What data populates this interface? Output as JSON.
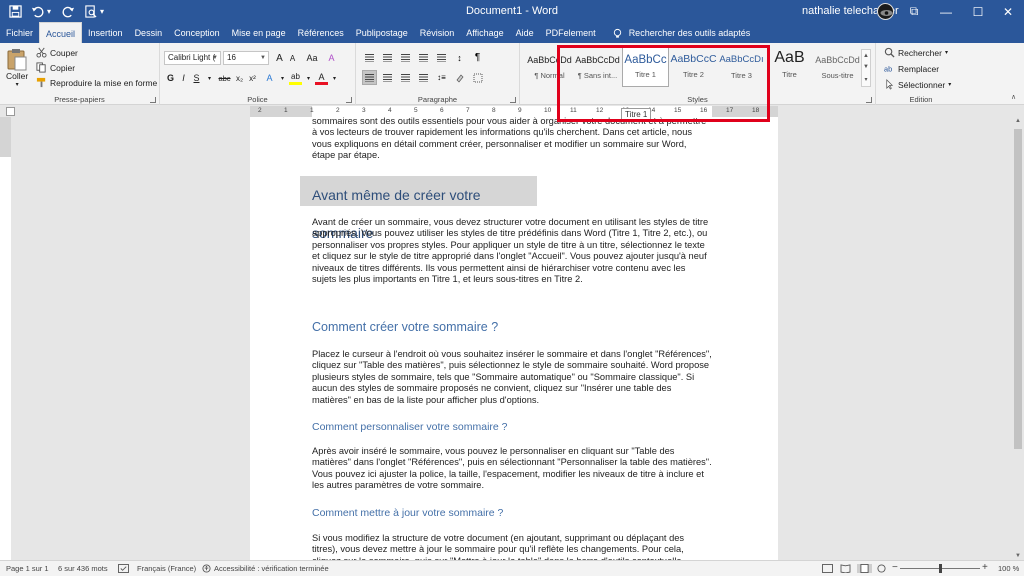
{
  "titlebar": {
    "doc_title": "Document1 - Word",
    "user_name": "nathalie telecharger",
    "icons": [
      "save-icon",
      "undo-icon",
      "redo-icon",
      "print-preview-icon",
      "ribbon-display-icon",
      "minimize-icon",
      "maximize-icon",
      "close-icon"
    ],
    "undo_dd": "▾",
    "qat_dd": "▾",
    "btn_ribbon": "⧉",
    "btn_min": "—",
    "btn_max": "☐",
    "btn_close": "✕"
  },
  "tabs": [
    "Fichier",
    "Accueil",
    "Insertion",
    "Dessin",
    "Conception",
    "Mise en page",
    "Références",
    "Publipostage",
    "Révision",
    "Affichage",
    "Aide",
    "PDFelement"
  ],
  "active_tab": "Accueil",
  "search_label": "Rechercher des outils adaptés",
  "clipboard": {
    "paste": "Coller",
    "cut": "Couper",
    "copy": "Copier",
    "format_painter": "Reproduire la mise en forme",
    "label": "Presse-papiers"
  },
  "font": {
    "family": "Calibri Light (",
    "size": "16",
    "label": "Police",
    "btn_bold": "G",
    "btn_italic": "I",
    "btn_underline": "S",
    "btn_strike": "abc",
    "btn_sub": "x₂",
    "btn_sup": "x²",
    "btn_grow": "A",
    "btn_shrink": "A",
    "btn_case": "Aa",
    "btn_clear": "A",
    "btn_effects": "A",
    "btn_highlight": "ab",
    "btn_color": "A",
    "accent_color": "#e81123",
    "highlight_color": "#ffff00"
  },
  "paragraph": {
    "label": "Paragraphe",
    "btn_pilcrow": "¶",
    "btn_sort": "↕",
    "btn_line_spacing": "↕≡"
  },
  "styles": {
    "label": "Styles",
    "items": [
      {
        "preview": "AaBbCcDd",
        "name": "¶ Normal"
      },
      {
        "preview": "AaBbCcDd",
        "name": "¶ Sans int..."
      },
      {
        "preview": "AaBbCc",
        "name": "Titre 1"
      },
      {
        "preview": "AaBbCcC",
        "name": "Titre 2"
      },
      {
        "preview": "AaBbCcDı",
        "name": "Titre 3"
      },
      {
        "preview": "AaB",
        "name": "Titre"
      },
      {
        "preview": "AaBbCcDd",
        "name": "Sous-titre"
      }
    ],
    "tooltip": "Titre 1",
    "scroll_up": "▲",
    "scroll_down": "▼",
    "scroll_more": "▾"
  },
  "editing": {
    "label": "Edition",
    "find": "Rechercher",
    "find_dd": "▾",
    "replace": "Remplacer",
    "select": "Sélectionner",
    "select_dd": "▾"
  },
  "ruler_numbers": [
    "2",
    "1",
    "1",
    "2",
    "3",
    "4",
    "5",
    "6",
    "7",
    "8",
    "9",
    "10",
    "11",
    "12",
    "13",
    "14",
    "15",
    "16",
    "17",
    "18"
  ],
  "document": {
    "intro": "sommaires sont des outils essentiels pour vous aider à organiser votre document et à permettre à vos lecteurs de trouver rapidement les informations qu'ils cherchent. Dans cet article, nous vous expliquons en détail comment créer, personnaliser et modifier un sommaire sur Word, étape par étape.",
    "heading1": "Avant même de créer votre sommaire",
    "para1": "Avant de créer un sommaire, vous devez structurer votre document en utilisant les styles de titre appropriés. Vous pouvez utiliser les styles de titre prédéfinis dans Word (Titre 1, Titre 2, etc.), ou personnaliser vos propres styles. Pour appliquer un style de titre à un titre, sélectionnez le texte et cliquez sur le style de titre approprié dans l'onglet \"Accueil\". Vous pouvez ajouter jusqu'à neuf niveaux de titres différents. Ils vous permettent ainsi de hiérarchiser votre contenu avec les sujets les plus importants en Titre 1, et leurs sous-titres en Titre 2.",
    "heading2": "Comment créer votre sommaire ?",
    "para2": "Placez le curseur à l'endroit où vous souhaitez insérer le sommaire et dans l'onglet \"Références\", cliquez sur \"Table des matières\", puis sélectionnez le style de sommaire souhaité. Word propose plusieurs styles de sommaire, tels que \"Sommaire automatique\" ou \"Sommaire classique\". Si aucun des styles de sommaire proposés ne convient, cliquez sur \"Insérer une table des matières\" en bas de la liste pour afficher plus d'options.",
    "heading3": "Comment personnaliser votre sommaire ?",
    "para3": "Après avoir inséré le sommaire, vous pouvez le personnaliser en cliquant sur \"Table des matières\" dans l'onglet \"Références\", puis en sélectionnant \"Personnaliser la table des matières\". Vous pouvez ici ajuster la police, la taille, l'espacement, modifier les niveaux de titre à inclure et les autres paramètres de votre sommaire.",
    "heading4": "Comment mettre à jour votre sommaire ?",
    "para4": "Si vous modifiez la structure de votre document (en ajoutant, supprimant ou déplaçant des titres), vous devez mettre à jour le sommaire pour qu'il reflète les changements. Pour cela, cliquez sur le sommaire, puis sur \"Mettre à jour la table\" dans la barre d'outils contextuelle."
  },
  "status": {
    "page": "Page 1 sur 1",
    "words": "6 sur 436 mots",
    "language": "Français (France)",
    "accessibility": "Accessibilité : vérification terminée",
    "zoom": "100 %",
    "zoom_minus": "−",
    "zoom_plus": "+",
    "zoom_level": 0.5
  },
  "scrollbar": {
    "up": "▲",
    "down": "▼"
  }
}
